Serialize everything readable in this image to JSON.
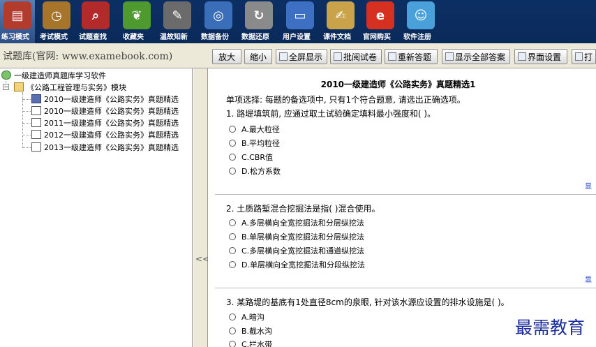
{
  "toolbar": {
    "items": [
      {
        "label": "练习模式",
        "icon": "books-icon",
        "color": "#b33b2e"
      },
      {
        "label": "考试模式",
        "icon": "clock-icon",
        "color": "#a7752a"
      },
      {
        "label": "试题查找",
        "icon": "magnifier-icon",
        "color": "#b22a2a"
      },
      {
        "label": "收藏夹",
        "icon": "leaf-icon",
        "color": "#4f9a2f"
      },
      {
        "label": "温故知新",
        "icon": "notebook-icon",
        "color": "#6b6b6b"
      },
      {
        "label": "数据备份",
        "icon": "disc-icon",
        "color": "#3a6eb8"
      },
      {
        "label": "数据还原",
        "icon": "refresh-icon",
        "color": "#8a8a8a"
      },
      {
        "label": "用户设置",
        "icon": "monitor-icon",
        "color": "#3d6fc2"
      },
      {
        "label": "课件文档",
        "icon": "document-icon",
        "color": "#c9a24a"
      },
      {
        "label": "官网购买",
        "icon": "ie-icon",
        "color": "#d63020"
      },
      {
        "label": "软件注册",
        "icon": "users-icon",
        "color": "#4aa0d8"
      }
    ]
  },
  "left": {
    "title": "试题库(官网: www.examebook.com)",
    "tree": {
      "root": "一级建造师真题库学习软件",
      "module": "《公路工程管理与实务》模块",
      "items": [
        "2010一级建造师《公路实务》真题精选",
        "2010一级建造师《公路实务》真题精选",
        "2011一级建造师《公路实务》真题精选",
        "2012一级建造师《公路实务》真题精选",
        "2013一级建造师《公路实务》真题精选"
      ]
    },
    "collapse": "<<"
  },
  "rtoolbar": {
    "buttons": [
      "放大",
      "缩小",
      "全屏显示",
      "批阅试卷",
      "重新答题",
      "显示全部答案",
      "界面设置",
      "打"
    ]
  },
  "content": {
    "title": "2010一级建造师《公路实务》真题精选1",
    "instruction": "单项选择: 每题的备选项中, 只有1个符合题意, 请选出正确选项。",
    "questions": [
      {
        "text": "1. 路堤填筑前, 应通过取土试验确定填料最小强度和( )。",
        "options": [
          "A.最大粒径",
          "B.平均粒径",
          "C.CBR值",
          "D.松方系数"
        ]
      },
      {
        "text": "2. 土质路堑混合挖掘法是指( )混合使用。",
        "options": [
          "A.多层横向全宽挖掘法和分层纵挖法",
          "B.单层横向全宽挖掘法和分层纵挖法",
          "C.多层横向全宽挖掘法和通道纵挖法",
          "D.单层横向全宽挖掘法和分段纵挖法"
        ]
      },
      {
        "text": "3. 某路堤的基底有1处直径8cm的泉眼, 针对该水源应设置的排水设施是( )。",
        "options": [
          "A.暗沟",
          "B.截水沟",
          "C.拦水带"
        ]
      }
    ],
    "more_label": "显",
    "watermark": "最需教育"
  }
}
